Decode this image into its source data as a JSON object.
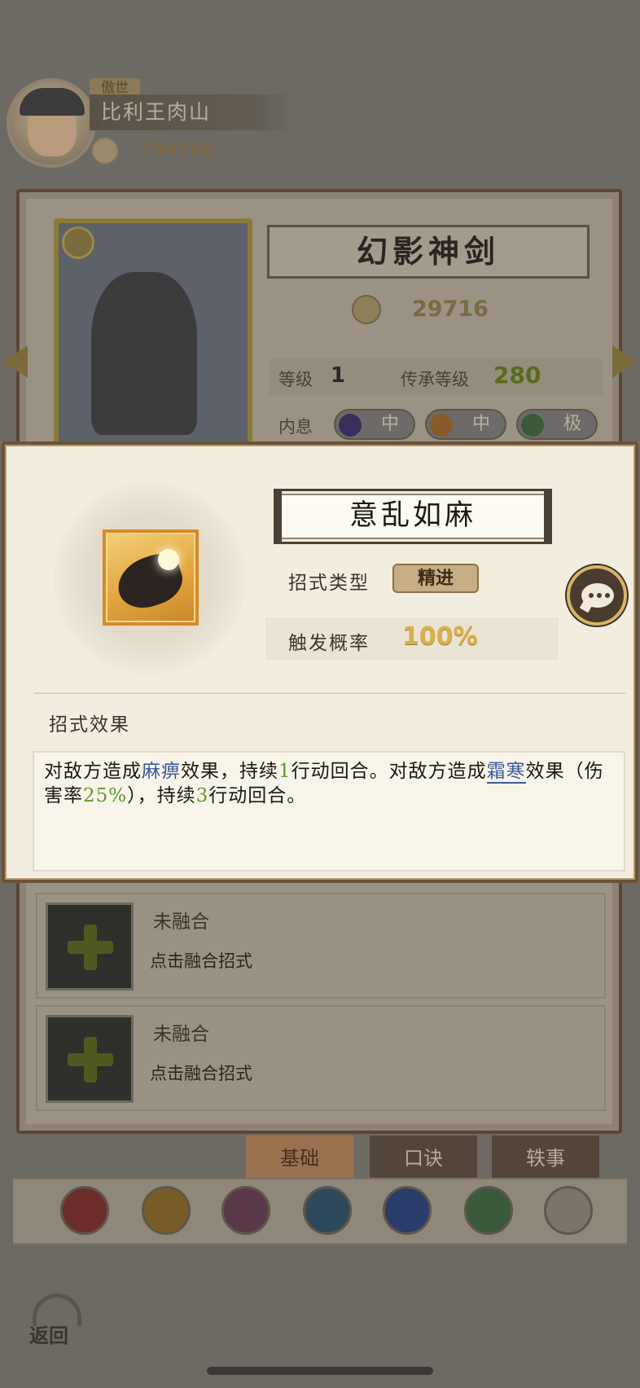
{
  "player": {
    "title_badge": "傲世",
    "name": "比利王肉山",
    "power": "794756"
  },
  "weapon": {
    "name": "幻影神剑",
    "power": "29716",
    "level_label": "等级",
    "level_value": "1",
    "inherit_label": "传承等级",
    "inherit_value": "280",
    "neixi_label": "内息",
    "neixi_pills": [
      "中",
      "中",
      "极"
    ]
  },
  "skill_popup": {
    "name": "意乱如麻",
    "type_label": "招式类型",
    "type_value": "精进",
    "chance_label": "触发概率",
    "chance_value": "100%",
    "effect_heading": "招式效果",
    "effect_parts": {
      "p1": "对敌方造成",
      "k1": "麻痹",
      "p2": "效果，持续",
      "n1": "1",
      "p3": "行动回合。对敌方造成",
      "k2": "霜寒",
      "p4": "效果（伤害率",
      "n2": "25%",
      "p5": "），持续",
      "n3": "3",
      "p6": "行动回合。"
    }
  },
  "fusion_slots": [
    {
      "title": "未融合",
      "hint": "点击融合招式"
    },
    {
      "title": "未融合",
      "hint": "点击融合招式"
    }
  ],
  "tabs": [
    "基础",
    "口诀",
    "轶事"
  ],
  "category_icon_colors": [
    "#6b2e2a",
    "#7a5c2a",
    "#5a3a4a",
    "#2e4a5a",
    "#2a3c6a",
    "#3a5a3a",
    "#7c7468"
  ],
  "back_label": "返回"
}
